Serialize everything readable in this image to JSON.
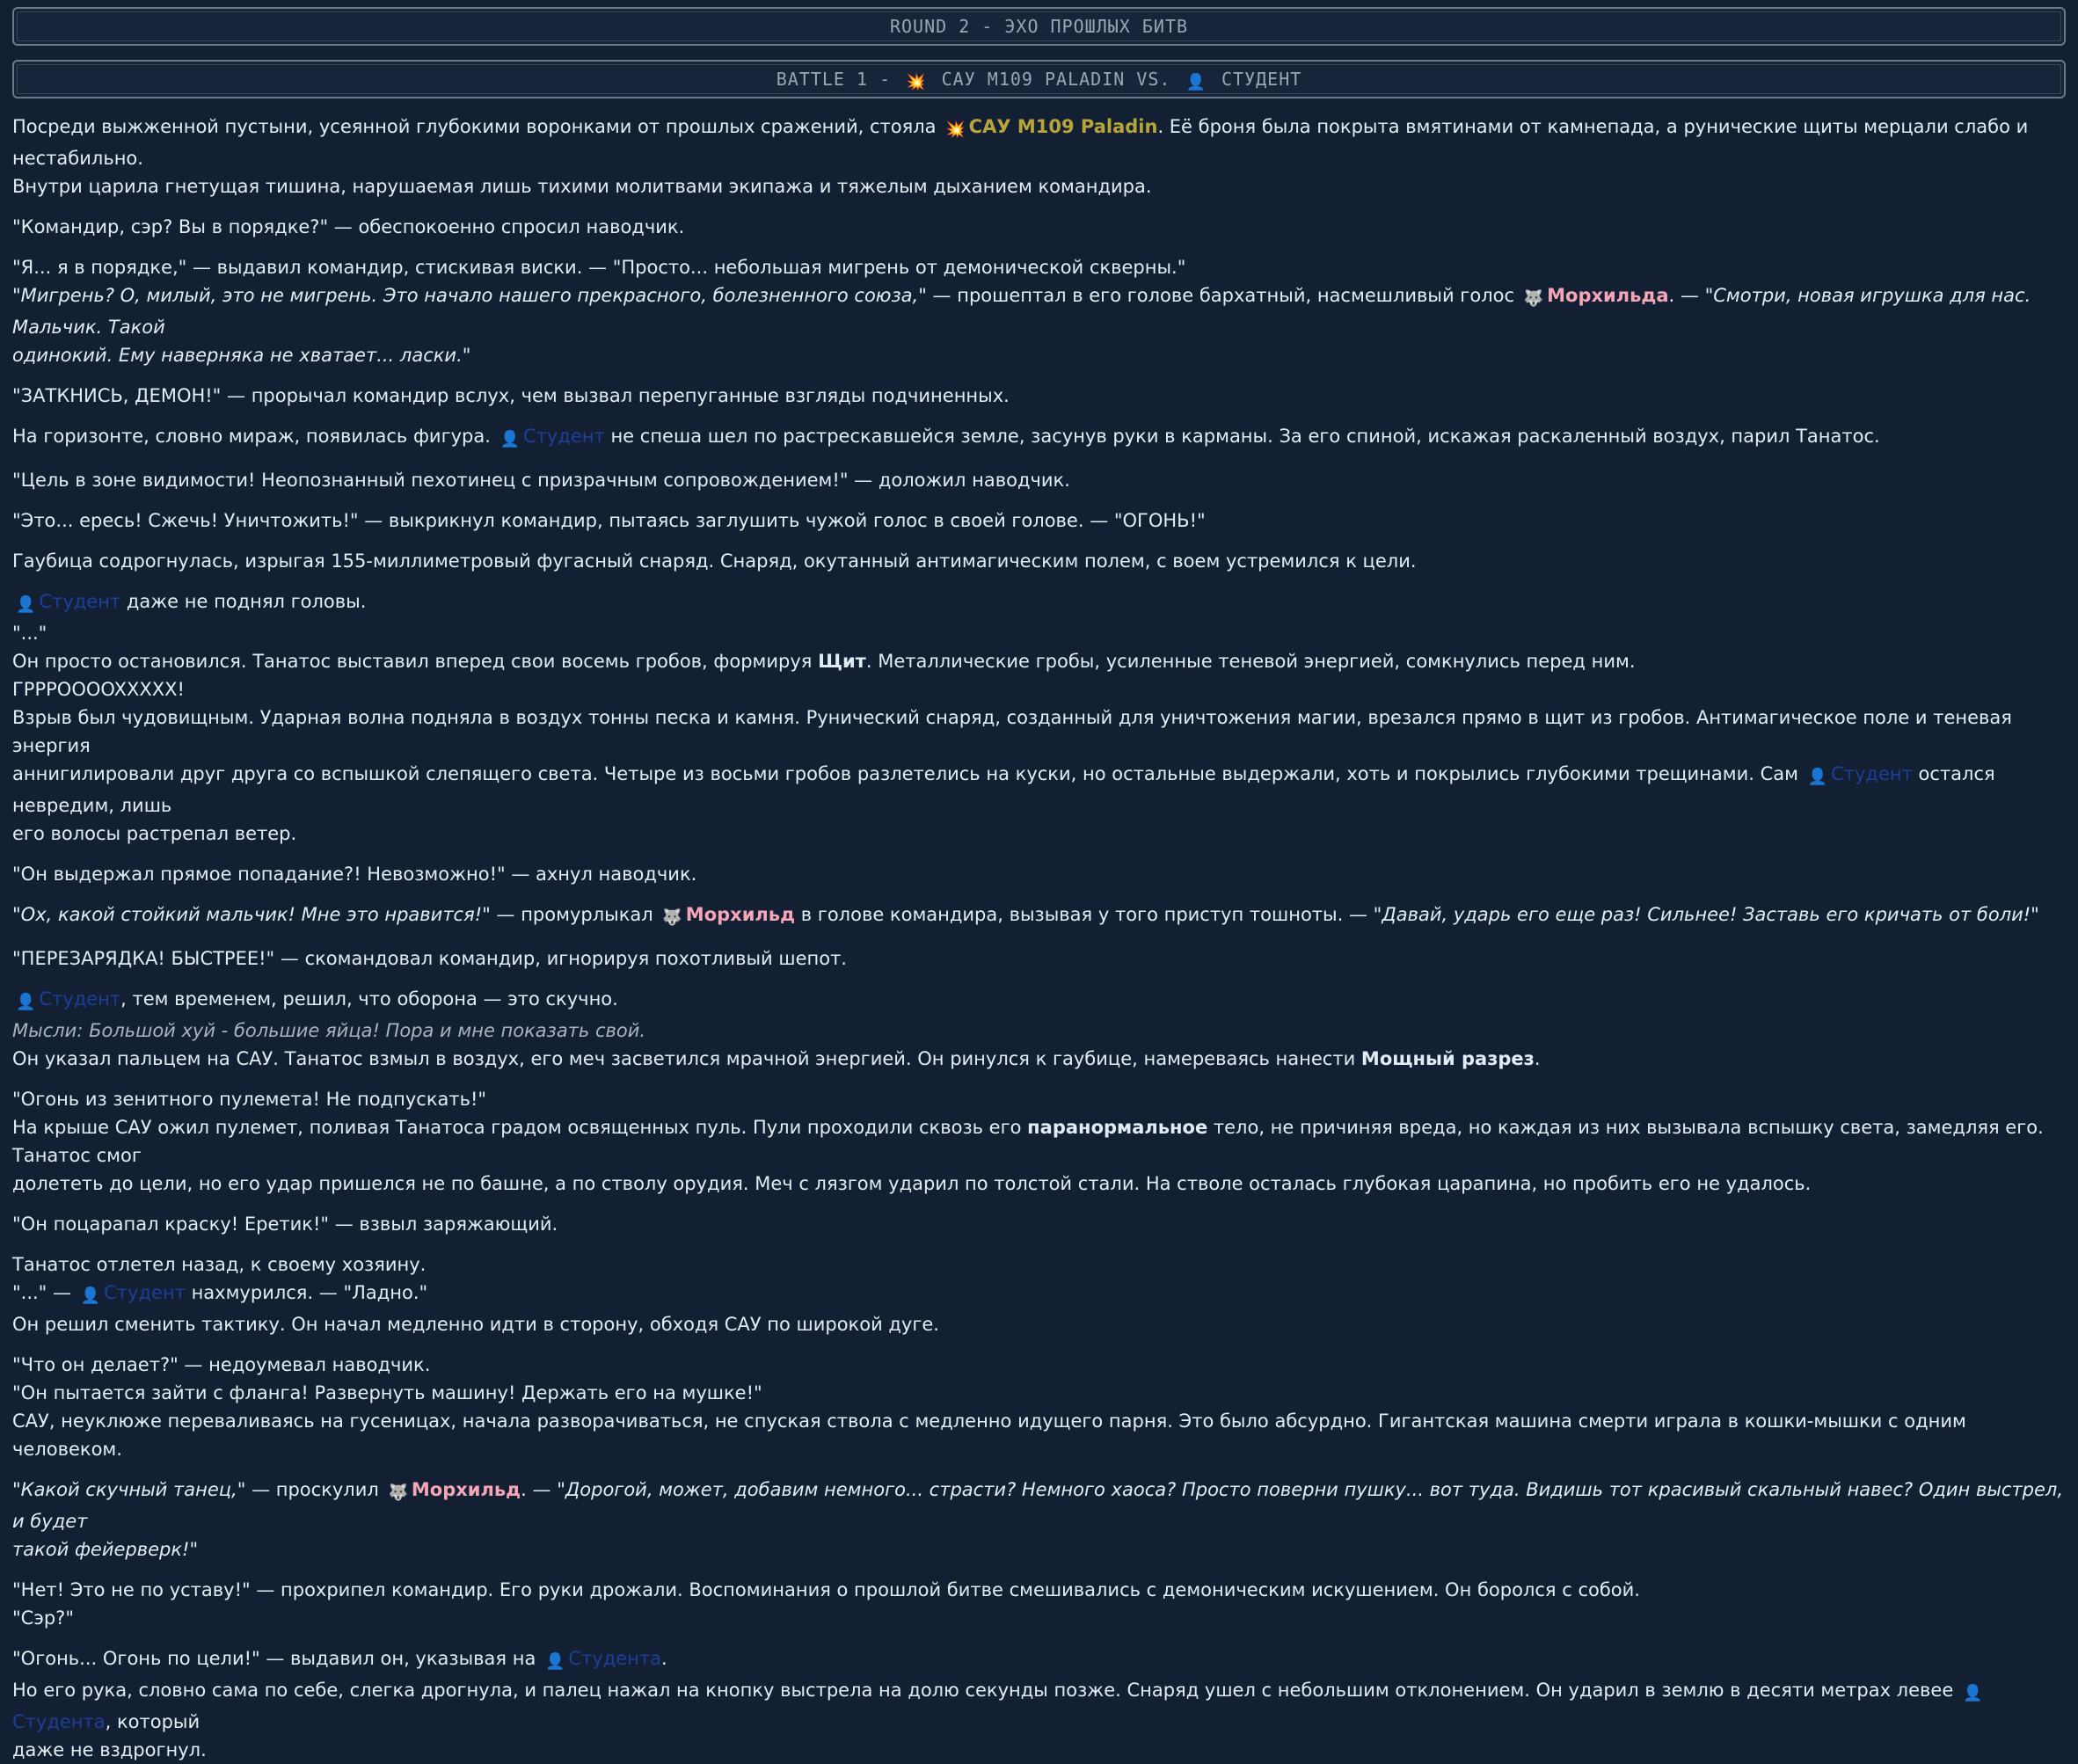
{
  "header": {
    "round": "ROUND 2 - ЭХО ПРОШЛЫХ БИТВ",
    "battle_prefix": "BATTLE 1 -",
    "battle_a": "САУ M109 PALADIN VS.",
    "battle_b": "СТУДЕНТ"
  },
  "names": {
    "paladin": "САУ M109 Paladin",
    "morhilda": "Морхильда",
    "morhild": "Морхильд",
    "student": "Студент",
    "studenta": "Студента",
    "icons": [
      "explosion-icon",
      "student-icon",
      "wolf-icon"
    ]
  },
  "text": {
    "p1a": "Посреди выжженной пустыни, усеянной глубокими воронками от прошлых сражений, стояла",
    "p1b": ". Её броня была покрыта вмятинами от камнепада, а рунические щиты мерцали слабо и нестабильно.",
    "p1c": "Внутри царила гнетущая тишина, нарушаемая лишь тихими молитвами экипажа и тяжелым дыханием командира.",
    "p2": "\"Командир, сэр? Вы в порядке?\" — обеспокоенно спросил наводчик.",
    "p3a": "\"Я... я в порядке,\" — выдавил командир, стискивая виски. — \"Просто... небольшая мигрень от демонической скверны.\"",
    "p3b_it": "\"Мигрень? О, милый, это не мигрень. Это начало нашего прекрасного, болезненного союза,\"",
    "p3b": "— прошептал в его голове бархатный, насмешливый голос",
    "p3c": ". —",
    "p3c_it": "\"Смотри, новая игрушка для нас. Мальчик. Такой",
    "p3d_it": "одинокий. Ему наверняка не хватает... ласки.\"",
    "p4": "\"ЗАТКНИСЬ, ДЕМОН!\" — прорычал командир вслух, чем вызвал перепуганные взгляды подчиненных.",
    "p5a": "На горизонте, словно мираж, появилась фигура.",
    "p5b": "не спеша шел по растрескавшейся земле, засунув руки в карманы. За его спиной, искажая раскаленный воздух, парил Танатос.",
    "p6": "\"Цель в зоне видимости! Неопознанный пехотинец с призрачным сопровождением!\" — доложил наводчик.",
    "p7": "\"Это... ересь! Сжечь! Уничтожить!\" — выкрикнул командир, пытаясь заглушить чужой голос в своей голове. — \"ОГОНЬ!\"",
    "p8": "Гаубица содрогнулась, изрыгая 155-миллиметровый фугасный снаряд. Снаряд, окутанный антимагическим полем, с воем устремился к цели.",
    "p9": "даже не поднял головы.",
    "p9b": "\"...\"",
    "p9c1": "Он просто остановился. Танатос выставил вперед свои восемь гробов, формируя",
    "p9c_b": "Щит",
    "p9c2": ". Металлические гробы, усиленные теневой энергией, сомкнулись перед ним.",
    "p9d": "ГРРРОООOXXXXX!",
    "p9e": "Взрыв был чудовищным. Ударная волна подняла в воздух тонны песка и камня. Рунический снаряд, созданный для уничтожения магии, врезался прямо в щит из гробов. Антимагическое поле и теневая энергия",
    "p9f": "аннигилировали друг друга со вспышкой слепящего света. Четыре из восьми гробов разлетелись на куски, но остальные выдержали, хоть и покрылись глубокими трещинами. Сам",
    "p9f2": "остался невредим, лишь",
    "p9g": "его волосы растрепал ветер.",
    "p10": "\"Он выдержал прямое попадание?! Невозможно!\" — ахнул наводчик.",
    "p11_it": "\"Ох, какой стойкий мальчик! Мне это нравится!\"",
    "p11a": "— промурлыкал",
    "p11b": "в голове командира, вызывая у того приступ тошноты. —",
    "p11_it2": "\"Давай, ударь его еще раз! Сильнее! Заставь его кричать от боли!\"",
    "p12": "\"ПЕРЕЗАРЯДКА! БЫСТРЕЕ!\" — скомандовал командир, игнорируя похотливый шепот.",
    "p13": ", тем временем, решил, что оборона — это скучно.",
    "p13b": "Мысли: Большой хуй - большие яйца! Пора и мне показать свой.",
    "p13c1": "Он указал пальцем на САУ. Танатос взмыл в воздух, его меч засветился мрачной энергией. Он ринулся к гаубице, намереваясь нанести",
    "p13c_b": "Мощный разрез",
    "p13c2": ".",
    "p14": "\"Огонь из зенитного пулемета! Не подпускать!\"",
    "p14b1": "На крыше САУ ожил пулемет, поливая Танатоса градом освященных пуль. Пули проходили сквозь его",
    "p14b_b": "паранормальное",
    "p14b2": "тело, не причиняя вреда, но каждая из них вызывала вспышку света, замедляя его. Танатос смог",
    "p14c": "долететь до цели, но его удар пришелся не по башне, а по стволу орудия. Меч с лязгом ударил по толстой стали. На стволе осталась глубокая царапина, но пробить его не удалось.",
    "p15": "\"Он поцарапал краску! Еретик!\" — взвыл заряжающий.",
    "p16": "Танатос отлетел назад, к своему хозяину.",
    "p16b1": "\"...\" —",
    "p16b2": "нахмурился. — \"Ладно.\"",
    "p16c": "Он решил сменить тактику. Он начал медленно идти в сторону, обходя САУ по широкой дуге.",
    "p17": "\"Что он делает?\" — недоумевал наводчик.",
    "p17b": "\"Он пытается зайти с фланга! Развернуть машину! Держать его на мушке!\"",
    "p17c": "САУ, неуклюже переваливаясь на гусеницах, начала разворачиваться, не спуская ствола с медленно идущего парня. Это было абсурдно. Гигантская машина смерти играла в кошки-мышки с одним человеком.",
    "p18_it": "\"Какой скучный танец,\"",
    "p18a": "— проскулил",
    "p18b": ". —",
    "p18_it2": "\"Дорогой, может, добавим немного... страсти? Немного хаоса? Просто поверни пушку... вот туда. Видишь тот красивый скальный навес? Один выстрел, и будет",
    "p18c_it": "такой фейерверк!\"",
    "p19": "\"Нет! Это не по уставу!\" — прохрипел командир. Его руки дрожали. Воспоминания о прошлой битве смешивались с демоническим искушением. Он боролся с собой.",
    "p19b": "\"Сэр?\"",
    "p20": "\"Огонь... Огонь по цели!\" — выдавил он, указывая на",
    "p20dot": ".",
    "p20b": "Но его рука, словно сама по себе, слегка дрогнула, и палец нажал на кнопку выстрела на долю секунды позже. Снаряд ушел с небольшим отклонением. Он ударил в землю в десяти метрах левее",
    "p20b2": ", который",
    "p20c": "даже не вздрогнул."
  }
}
